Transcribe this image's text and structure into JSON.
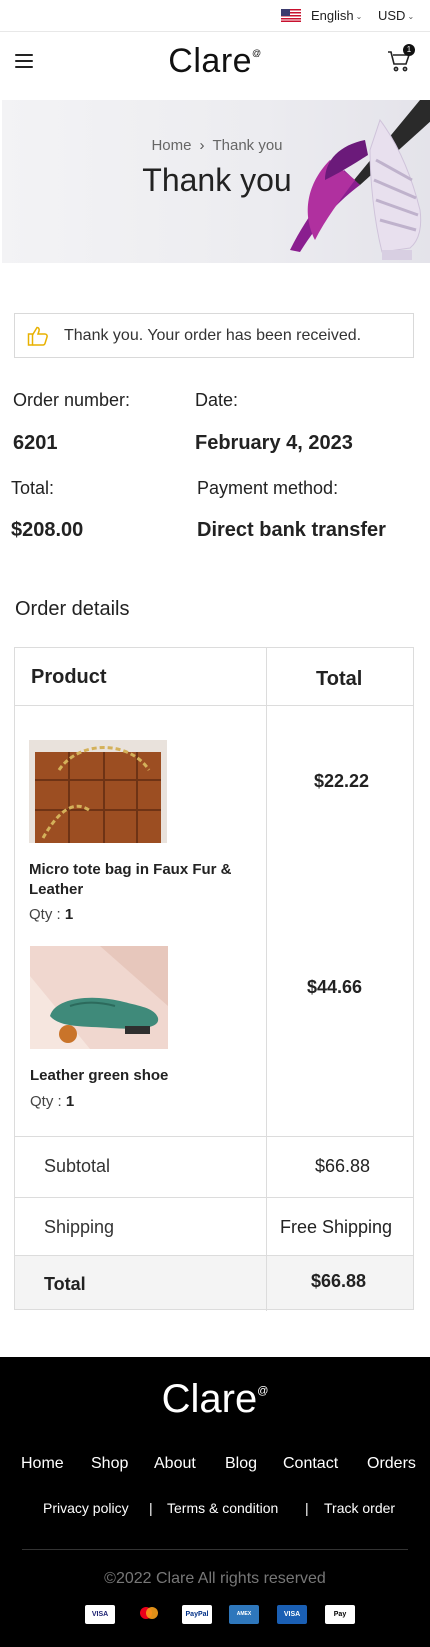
{
  "topbar": {
    "language": "English",
    "currency": "USD"
  },
  "header": {
    "logo": "Clare",
    "logo_mark": "@",
    "cart_count": "1"
  },
  "hero": {
    "breadcrumb": [
      "Home",
      "Thank you"
    ],
    "title": "Thank you"
  },
  "notice": {
    "text": "Thank you. Your order has been received."
  },
  "order": {
    "number_label": "Order number:",
    "number": "6201",
    "date_label": "Date:",
    "date": "February 4, 2023",
    "total_label": "Total:",
    "total": "$208.00",
    "payment_label": "Payment method:",
    "payment": "Direct bank transfer"
  },
  "details": {
    "title": "Order details",
    "col_product": "Product",
    "col_total": "Total",
    "items": [
      {
        "name": "Micro tote bag in Faux Fur & Leather",
        "qty_label": "Qty : ",
        "qty": "1",
        "price": "$22.22"
      },
      {
        "name": "Leather green shoe",
        "qty_label": "Qty : ",
        "qty": "1",
        "price": "$44.66"
      }
    ],
    "subtotal_label": "Subtotal",
    "subtotal": "$66.88",
    "shipping_label": "Shipping",
    "shipping": "Free Shipping",
    "total_label": "Total",
    "total": "$66.88"
  },
  "footer": {
    "logo": "Clare",
    "logo_mark": "@",
    "nav": [
      "Home",
      "Shop",
      "About",
      "Blog",
      "Contact",
      "Orders"
    ],
    "legal": [
      "Privacy policy",
      "Terms & condition",
      "Track order"
    ],
    "separator": "|",
    "copyright": "©2022 Clare All rights reserved",
    "payments": [
      "VISA",
      "mastercard",
      "PayPal",
      "AMERICAN EXPRESS",
      "VISA Electron",
      "Apple Pay"
    ]
  },
  "colors": {
    "footer_bg": "#000000",
    "accent_thumb": "#e8b100",
    "hero_bg": "#ececf0"
  }
}
